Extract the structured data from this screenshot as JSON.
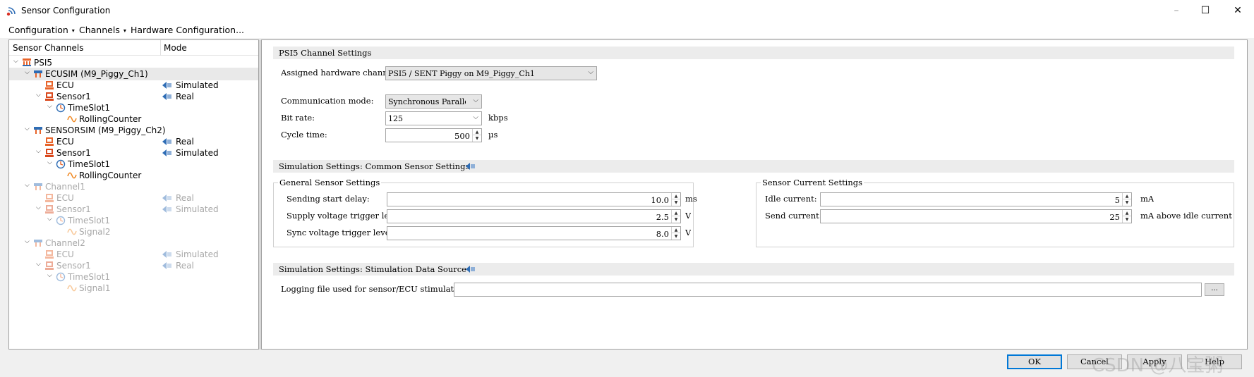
{
  "window": {
    "title": "Sensor Configuration",
    "minimize_glyph": "–",
    "maximize_glyph": "☐",
    "close_glyph": "✕"
  },
  "menu": {
    "configuration": "Configuration",
    "channels": "Channels",
    "hardware": "Hardware Configuration...",
    "arrow": "▾"
  },
  "tree": {
    "col_channels": "Sensor Channels",
    "col_mode": "Mode",
    "rows": [
      {
        "label": "PSI5",
        "mode": "",
        "icon": "psi5-bus-icon"
      },
      {
        "label": "ECUSIM (M9_Piggy_Ch1)",
        "mode": "",
        "icon": "channel-icon"
      },
      {
        "label": "ECU",
        "mode": "Simulated",
        "icon": "ecu-icon"
      },
      {
        "label": "Sensor1",
        "mode": "Real",
        "icon": "sensor-icon"
      },
      {
        "label": "TimeSlot1",
        "mode": "",
        "icon": "timeslot-icon"
      },
      {
        "label": "RollingCounter",
        "mode": "",
        "icon": "signal-icon"
      },
      {
        "label": "SENSORSIM (M9_Piggy_Ch2)",
        "mode": "",
        "icon": "channel-icon"
      },
      {
        "label": "ECU",
        "mode": "Real",
        "icon": "ecu-icon"
      },
      {
        "label": "Sensor1",
        "mode": "Simulated",
        "icon": "sensor-icon"
      },
      {
        "label": "TimeSlot1",
        "mode": "",
        "icon": "timeslot-icon"
      },
      {
        "label": "RollingCounter",
        "mode": "",
        "icon": "signal-icon"
      },
      {
        "label": "Channel1",
        "mode": "",
        "icon": "channel-icon"
      },
      {
        "label": "ECU",
        "mode": "Real",
        "icon": "ecu-icon"
      },
      {
        "label": "Sensor1",
        "mode": "Simulated",
        "icon": "sensor-icon"
      },
      {
        "label": "TimeSlot1",
        "mode": "",
        "icon": "timeslot-icon"
      },
      {
        "label": "Signal2",
        "mode": "",
        "icon": "signal-icon"
      },
      {
        "label": "Channel2",
        "mode": "",
        "icon": "channel-icon"
      },
      {
        "label": "ECU",
        "mode": "Simulated",
        "icon": "ecu-icon"
      },
      {
        "label": "Sensor1",
        "mode": "Real",
        "icon": "sensor-icon"
      },
      {
        "label": "TimeSlot1",
        "mode": "",
        "icon": "timeslot-icon"
      },
      {
        "label": "Signal1",
        "mode": "",
        "icon": "signal-icon"
      }
    ]
  },
  "psi5": {
    "section_title": "PSI5 Channel Settings",
    "hw_channel_label": "Assigned hardware channel",
    "hw_channel_value": "PSI5 / SENT Piggy on M9_Piggy_Ch1",
    "comm_mode_label": "Communication mode:",
    "comm_mode_value": "Synchronous Paralle",
    "bit_rate_label": "Bit rate:",
    "bit_rate_value": "125",
    "bit_rate_unit": "kbps",
    "cycle_time_label": "Cycle time:",
    "cycle_time_value": "500",
    "cycle_time_unit": "µs"
  },
  "common": {
    "section_title": "Simulation Settings: Common Sensor Settings",
    "general_title": "General Sensor Settings",
    "send_delay_label": "Sending start delay:",
    "send_delay_value": "10.0",
    "send_delay_unit": "ms",
    "supply_trigger_label": "Supply voltage trigger le",
    "supply_trigger_value": "2.5",
    "supply_trigger_unit": "V",
    "sync_trigger_label": "Sync voltage trigger leve",
    "sync_trigger_value": "8.0",
    "sync_trigger_unit": "V",
    "current_title": "Sensor Current Settings",
    "idle_label": "Idle current:",
    "idle_value": "5",
    "idle_unit": "mA",
    "send_current_label": "Send current:",
    "send_current_value": "25",
    "send_current_unit": "mA above idle current"
  },
  "stimulation": {
    "section_title": "Simulation Settings: Stimulation Data Source",
    "logfile_label": "Logging file used for sensor/ECU stimulat",
    "logfile_value": "",
    "browse_label": "..."
  },
  "buttons": {
    "ok": "OK",
    "cancel": "Cancel",
    "apply": "Apply",
    "help": "Help"
  },
  "watermark": "CSDN @八宝粥",
  "colors": {
    "accent": "#0078d7",
    "ecu_orange": "#e8642a",
    "mode_blue": "#2f6db5",
    "signal_orange": "#f08a24"
  }
}
